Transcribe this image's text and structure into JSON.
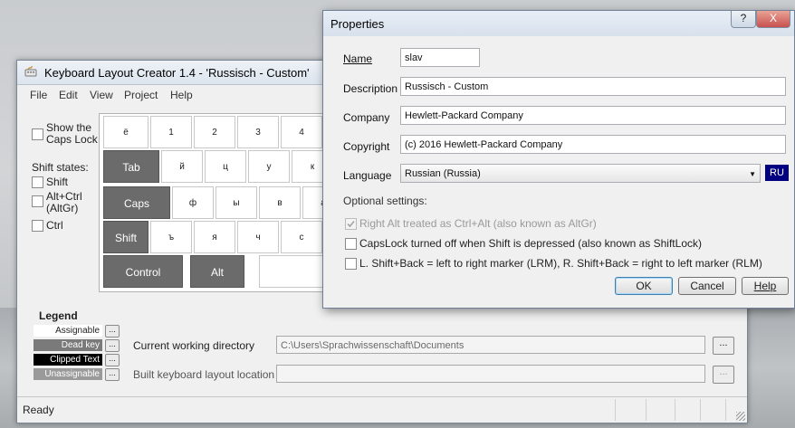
{
  "main_window": {
    "title": "Keyboard Layout Creator 1.4 - 'Russisch - Custom'",
    "menu": [
      "File",
      "Edit",
      "View",
      "Project",
      "Help"
    ],
    "show_caps_lock_line1": "Show the",
    "show_caps_lock_line2": "Caps Lock",
    "shift_states_label": "Shift states:",
    "shift_label": "Shift",
    "altctrl_line1": "Alt+Ctrl",
    "altctrl_line2": "(AltGr)",
    "ctrl_label": "Ctrl",
    "keys": {
      "row1": [
        "ё",
        "1",
        "2",
        "3",
        "4"
      ],
      "tab": "Tab",
      "row2": [
        "й",
        "ц",
        "у",
        "к"
      ],
      "caps": "Caps",
      "row3": [
        "ф",
        "ы",
        "в",
        "а"
      ],
      "shift": "Shift",
      "row4": [
        "ъ",
        "я",
        "ч",
        "с"
      ],
      "control": "Control",
      "alt": "Alt"
    },
    "legend": {
      "title": "Legend",
      "items": [
        "Assignable",
        "Dead key",
        "Clipped Text",
        "Unassignable"
      ],
      "button_label": "..."
    },
    "working_dir_label": "Current working directory",
    "working_dir_value": "C:\\Users\\Sprachwissenschaft\\Documents",
    "build_location_label": "Built keyboard layout location",
    "build_location_value": "",
    "browse_label": "...",
    "status": "Ready"
  },
  "dialog": {
    "title": "Properties",
    "help_btn": "?",
    "close_btn": "X",
    "name_label": "Name",
    "name_value": "slav",
    "description_label": "Description",
    "description_value": "Russisch - Custom",
    "company_label": "Company",
    "company_value": "Hewlett-Packard Company",
    "copyright_label": "Copyright",
    "copyright_value": "(c) 2016 Hewlett-Packard Company",
    "language_label": "Language",
    "language_value": "Russian (Russia)",
    "language_code": "RU",
    "optional_label": "Optional settings:",
    "options": [
      {
        "label": "Right Alt treated as Ctrl+Alt (also known as AltGr)",
        "checked": true,
        "enabled": false
      },
      {
        "label": "CapsLock turned off when Shift is depressed (also known as ShiftLock)",
        "checked": false,
        "enabled": true
      },
      {
        "label": "L. Shift+Back = left to right marker (LRM),  R. Shift+Back = right to left marker (RLM)",
        "checked": false,
        "enabled": true
      }
    ],
    "ok": "OK",
    "cancel": "Cancel",
    "help": "Help"
  },
  "colors": {
    "accent_blue": "#000080",
    "key_dark": "#6b6b6b",
    "close_red": "#c75050"
  }
}
